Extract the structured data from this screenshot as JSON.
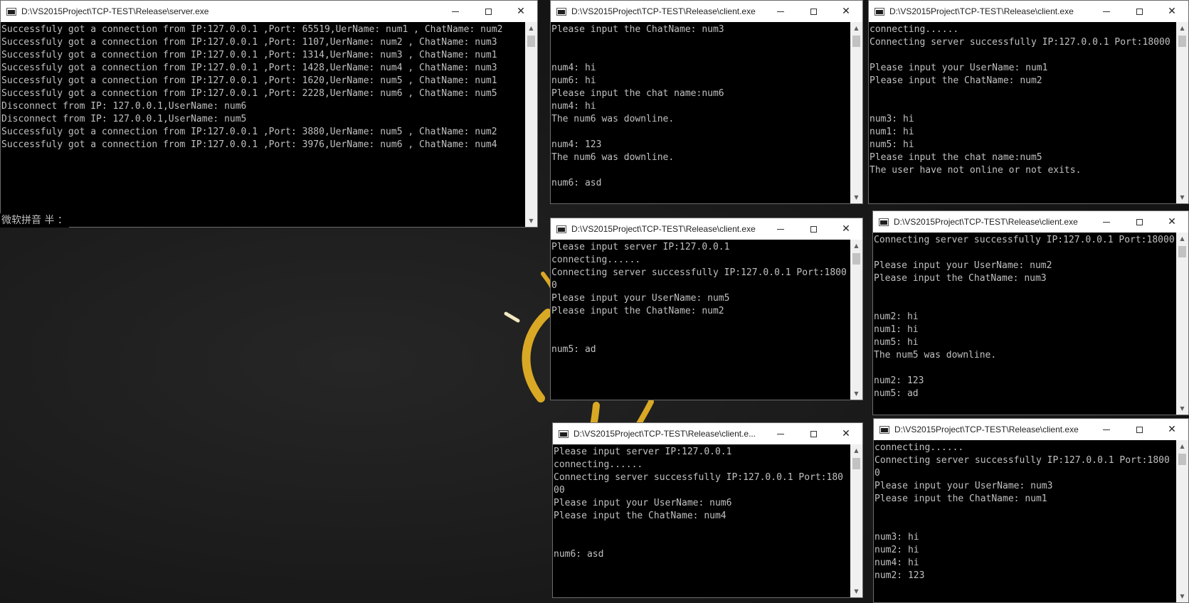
{
  "windows": [
    {
      "id": "server",
      "title": "D:\\VS2015Project\\TCP-TEST\\Release\\server.exe",
      "lines": [
        "Successfuly got a connection from IP:127.0.0.1 ,Port: 65519,UerName: num1 , ChatName: num2",
        "Successfuly got a connection from IP:127.0.0.1 ,Port: 1107,UerName: num2 , ChatName: num3",
        "Successfuly got a connection from IP:127.0.0.1 ,Port: 1314,UerName: num3 , ChatName: num1",
        "Successfuly got a connection from IP:127.0.0.1 ,Port: 1428,UerName: num4 , ChatName: num3",
        "Successfuly got a connection from IP:127.0.0.1 ,Port: 1620,UerName: num5 , ChatName: num1",
        "Successfuly got a connection from IP:127.0.0.1 ,Port: 2228,UerName: num6 , ChatName: num5",
        "Disconnect from IP: 127.0.0.1,UserName: num6",
        "Disconnect from IP: 127.0.0.1,UserName: num5",
        "Successfuly got a connection from IP:127.0.0.1 ,Port: 3880,UerName: num5 , ChatName: num2",
        "Successfuly got a connection from IP:127.0.0.1 ,Port: 3976,UerName: num6 , ChatName: num4"
      ]
    },
    {
      "id": "client-num4",
      "title": "D:\\VS2015Project\\TCP-TEST\\Release\\client.exe",
      "lines": [
        "Please input the ChatName: num3",
        "",
        "",
        "num4: hi",
        "num6: hi",
        "Please input the chat name:num6",
        "num4: hi",
        "The num6 was downline.",
        "",
        "num4: 123",
        "The num6 was downline.",
        "",
        "num6: asd"
      ]
    },
    {
      "id": "client-num1",
      "title": "D:\\VS2015Project\\TCP-TEST\\Release\\client.exe",
      "lines": [
        "connecting......",
        "Connecting server successfully IP:127.0.0.1 Port:18000",
        "",
        "Please input your UserName: num1",
        "Please input the ChatName: num2",
        "",
        "",
        "num3: hi",
        "num1: hi",
        "num5: hi",
        "Please input the chat name:num5",
        "The user have not online or not exits."
      ]
    },
    {
      "id": "client-num5",
      "title": "D:\\VS2015Project\\TCP-TEST\\Release\\client.exe",
      "lines": [
        "Please input server IP:127.0.0.1",
        "connecting......",
        "Connecting server successfully IP:127.0.0.1 Port:1800",
        "0",
        "Please input your UserName: num5",
        "Please input the ChatName: num2",
        "",
        "",
        "num5: ad"
      ]
    },
    {
      "id": "client-num2",
      "title": "D:\\VS2015Project\\TCP-TEST\\Release\\client.exe",
      "lines": [
        "Connecting server successfully IP:127.0.0.1 Port:18000",
        "",
        "Please input your UserName: num2",
        "Please input the ChatName: num3",
        "",
        "",
        "num2: hi",
        "num1: hi",
        "num5: hi",
        "The num5 was downline.",
        "",
        "num2: 123",
        "num5: ad"
      ]
    },
    {
      "id": "client-num6",
      "title": "D:\\VS2015Project\\TCP-TEST\\Release\\client.e...",
      "lines": [
        "Please input server IP:127.0.0.1",
        "connecting......",
        "Connecting server successfully IP:127.0.0.1 Port:180",
        "00",
        "Please input your UserName: num6",
        "Please input the ChatName: num4",
        "",
        "",
        "num6: asd"
      ]
    },
    {
      "id": "client-num3",
      "title": "D:\\VS2015Project\\TCP-TEST\\Release\\client.exe",
      "lines": [
        "connecting......",
        "Connecting server successfully IP:127.0.0.1 Port:1800",
        "0",
        "Please input your UserName: num3",
        "Please input the ChatName: num1",
        "",
        "",
        "num3: hi",
        "num2: hi",
        "num4: hi",
        "num2: 123"
      ]
    }
  ],
  "ime_status": "微软拼音 半 ："
}
